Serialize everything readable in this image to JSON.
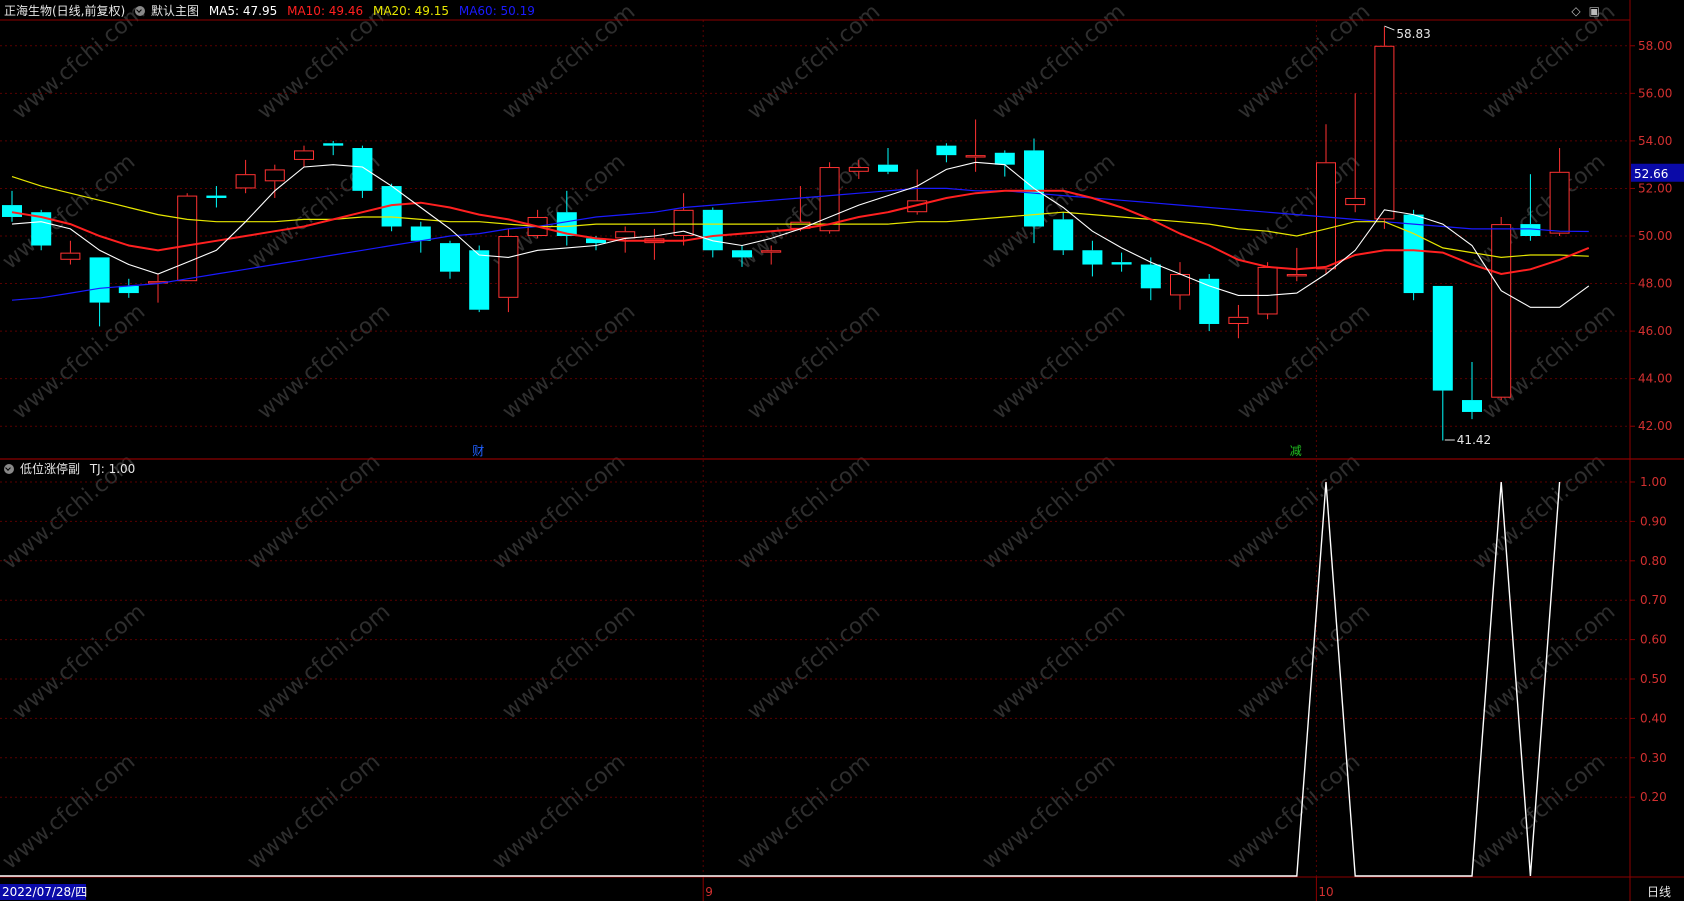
{
  "header": {
    "stock": "正海生物(日线,前复权)",
    "template": "默认主图",
    "ma5": "MA5: 47.95",
    "ma10": "MA10: 49.46",
    "ma20": "MA20: 49.15",
    "ma60": "MA60: 50.19"
  },
  "lower_header": {
    "indicator": "低位涨停副",
    "tj": "TJ: 1.00"
  },
  "price_axis_labels": [
    "58.00",
    "56.00",
    "54.00",
    "52.00",
    "50.00",
    "48.00",
    "46.00",
    "44.00",
    "42.00"
  ],
  "current_price": "52.66",
  "high_marker": "58.83",
  "low_marker": "41.42",
  "event_marks": [
    "财",
    "减"
  ],
  "ind_axis_labels": [
    "1.00",
    "0.90",
    "0.80",
    "0.70",
    "0.60",
    "0.50",
    "0.40",
    "0.30",
    "0.20"
  ],
  "date_label": "2022/07/28/四",
  "month_labels": [
    "9",
    "10"
  ],
  "period": "日线",
  "watermark": "www.cfchi.com",
  "colors": {
    "up": "#ff3232",
    "down": "#00ffff",
    "ma5": "#ffffff",
    "ma10": "#ff2020",
    "ma20": "#e6e600",
    "ma60": "#1a1aff"
  },
  "chart_data": {
    "type": "candlestick",
    "candles": [
      {
        "o": 51.3,
        "c": 50.8,
        "h": 51.9,
        "l": 50.6
      },
      {
        "o": 51.0,
        "c": 49.6,
        "h": 51.1,
        "l": 49.4
      },
      {
        "o": 49.0,
        "c": 49.3,
        "h": 49.8,
        "l": 48.8
      },
      {
        "o": 49.1,
        "c": 47.2,
        "h": 49.1,
        "l": 46.2
      },
      {
        "o": 47.9,
        "c": 47.6,
        "h": 48.2,
        "l": 47.4
      },
      {
        "o": 48.0,
        "c": 48.1,
        "h": 48.4,
        "l": 47.2
      },
      {
        "o": 48.1,
        "c": 51.7,
        "h": 51.8,
        "l": 48.1
      },
      {
        "o": 51.7,
        "c": 51.6,
        "h": 52.1,
        "l": 51.2
      },
      {
        "o": 52.0,
        "c": 52.6,
        "h": 53.2,
        "l": 51.8
      },
      {
        "o": 52.3,
        "c": 52.8,
        "h": 53.0,
        "l": 51.6
      },
      {
        "o": 53.2,
        "c": 53.6,
        "h": 53.8,
        "l": 52.9
      },
      {
        "o": 53.9,
        "c": 53.8,
        "h": 54.0,
        "l": 53.4
      },
      {
        "o": 53.7,
        "c": 51.9,
        "h": 53.8,
        "l": 51.6
      },
      {
        "o": 52.1,
        "c": 50.4,
        "h": 52.2,
        "l": 50.2
      },
      {
        "o": 50.4,
        "c": 49.8,
        "h": 50.6,
        "l": 49.3
      },
      {
        "o": 49.7,
        "c": 48.5,
        "h": 49.8,
        "l": 48.2
      },
      {
        "o": 49.4,
        "c": 46.9,
        "h": 49.6,
        "l": 46.8
      },
      {
        "o": 47.4,
        "c": 50.0,
        "h": 50.3,
        "l": 46.8
      },
      {
        "o": 50.0,
        "c": 50.8,
        "h": 51.1,
        "l": 49.9
      },
      {
        "o": 51.0,
        "c": 50.0,
        "h": 51.9,
        "l": 49.6
      },
      {
        "o": 49.9,
        "c": 49.7,
        "h": 50.0,
        "l": 49.4
      },
      {
        "o": 49.9,
        "c": 50.2,
        "h": 50.4,
        "l": 49.3
      },
      {
        "o": 49.7,
        "c": 49.9,
        "h": 50.3,
        "l": 49.0
      },
      {
        "o": 50.0,
        "c": 51.1,
        "h": 51.8,
        "l": 49.6
      },
      {
        "o": 51.1,
        "c": 49.4,
        "h": 51.2,
        "l": 49.1
      },
      {
        "o": 49.4,
        "c": 49.1,
        "h": 49.6,
        "l": 48.7
      },
      {
        "o": 49.3,
        "c": 49.4,
        "h": 49.6,
        "l": 48.8
      },
      {
        "o": 50.3,
        "c": 50.6,
        "h": 52.1,
        "l": 50.2
      },
      {
        "o": 50.2,
        "c": 52.9,
        "h": 53.1,
        "l": 50.1
      },
      {
        "o": 52.7,
        "c": 52.9,
        "h": 53.2,
        "l": 52.4
      },
      {
        "o": 53.0,
        "c": 52.7,
        "h": 53.7,
        "l": 52.6
      },
      {
        "o": 51.0,
        "c": 51.5,
        "h": 52.8,
        "l": 50.9
      },
      {
        "o": 53.8,
        "c": 53.4,
        "h": 53.9,
        "l": 53.1
      },
      {
        "o": 53.3,
        "c": 53.4,
        "h": 54.9,
        "l": 52.7
      },
      {
        "o": 53.5,
        "c": 53.0,
        "h": 53.6,
        "l": 52.5
      },
      {
        "o": 53.6,
        "c": 50.4,
        "h": 54.1,
        "l": 49.7
      },
      {
        "o": 50.7,
        "c": 49.4,
        "h": 51.0,
        "l": 49.2
      },
      {
        "o": 49.4,
        "c": 48.8,
        "h": 49.8,
        "l": 48.3
      },
      {
        "o": 48.9,
        "c": 48.8,
        "h": 49.3,
        "l": 48.5
      },
      {
        "o": 48.8,
        "c": 47.8,
        "h": 49.1,
        "l": 47.3
      },
      {
        "o": 47.5,
        "c": 48.4,
        "h": 48.9,
        "l": 46.9
      },
      {
        "o": 48.2,
        "c": 46.3,
        "h": 48.4,
        "l": 46.0
      },
      {
        "o": 46.3,
        "c": 46.6,
        "h": 47.1,
        "l": 45.7
      },
      {
        "o": 46.7,
        "c": 48.7,
        "h": 48.9,
        "l": 46.5
      },
      {
        "o": 48.3,
        "c": 48.4,
        "h": 49.5,
        "l": 48.1
      },
      {
        "o": 48.6,
        "c": 53.1,
        "h": 54.7,
        "l": 48.4
      },
      {
        "o": 51.3,
        "c": 51.6,
        "h": 56.0,
        "l": 51.0
      },
      {
        "o": 50.7,
        "c": 58.0,
        "h": 58.8,
        "l": 50.3
      },
      {
        "o": 50.9,
        "c": 47.6,
        "h": 51.1,
        "l": 47.3
      },
      {
        "o": 47.9,
        "c": 43.5,
        "h": 47.9,
        "l": 41.4
      },
      {
        "o": 43.1,
        "c": 42.6,
        "h": 44.7,
        "l": 42.3
      },
      {
        "o": 43.2,
        "c": 50.5,
        "h": 50.8,
        "l": 43.1
      },
      {
        "o": 50.5,
        "c": 50.0,
        "h": 52.6,
        "l": 49.8
      },
      {
        "o": 50.1,
        "c": 52.7,
        "h": 53.7,
        "l": 50.0
      }
    ],
    "ma5": [
      50.5,
      50.6,
      50.3,
      49.4,
      48.8,
      48.4,
      48.9,
      49.4,
      50.6,
      51.9,
      52.9,
      53.0,
      52.9,
      52.1,
      51.2,
      50.3,
      49.2,
      49.1,
      49.4,
      49.5,
      49.6,
      49.9,
      50.0,
      50.2,
      49.8,
      49.6,
      49.9,
      50.3,
      50.8,
      51.3,
      51.7,
      52.1,
      52.8,
      53.1,
      53.0,
      52.0,
      51.2,
      50.2,
      49.5,
      48.9,
      48.4,
      47.9,
      47.5,
      47.5,
      47.6,
      48.4,
      49.4,
      51.1,
      50.9,
      50.5,
      49.6,
      47.7,
      47.0,
      47.0,
      47.9
    ],
    "ma10": [
      51.0,
      50.8,
      50.5,
      50.0,
      49.6,
      49.4,
      49.6,
      49.8,
      50.0,
      50.2,
      50.4,
      50.7,
      51.0,
      51.3,
      51.4,
      51.2,
      50.9,
      50.7,
      50.4,
      50.1,
      49.9,
      49.8,
      49.8,
      49.8,
      50.0,
      50.1,
      50.2,
      50.3,
      50.5,
      50.8,
      51.0,
      51.3,
      51.6,
      51.8,
      51.9,
      51.9,
      51.9,
      51.6,
      51.2,
      50.7,
      50.1,
      49.6,
      49.0,
      48.7,
      48.6,
      48.7,
      49.2,
      49.4,
      49.4,
      49.3,
      48.8,
      48.4,
      48.6,
      49.0,
      49.5
    ],
    "ma20": [
      52.5,
      52.1,
      51.8,
      51.5,
      51.2,
      50.9,
      50.7,
      50.6,
      50.6,
      50.6,
      50.7,
      50.7,
      50.8,
      50.8,
      50.7,
      50.6,
      50.6,
      50.5,
      50.4,
      50.4,
      50.5,
      50.5,
      50.5,
      50.5,
      50.5,
      50.5,
      50.5,
      50.5,
      50.5,
      50.5,
      50.5,
      50.6,
      50.6,
      50.7,
      50.8,
      50.9,
      51.0,
      50.9,
      50.8,
      50.7,
      50.6,
      50.5,
      50.3,
      50.2,
      50.0,
      50.3,
      50.6,
      50.6,
      50.1,
      49.5,
      49.3,
      49.1,
      49.2,
      49.2,
      49.15
    ],
    "ma60": [
      47.3,
      47.4,
      47.6,
      47.8,
      47.9,
      48.0,
      48.2,
      48.4,
      48.6,
      48.8,
      49.0,
      49.2,
      49.4,
      49.6,
      49.8,
      50.0,
      50.1,
      50.3,
      50.4,
      50.6,
      50.8,
      50.9,
      51.0,
      51.2,
      51.3,
      51.4,
      51.5,
      51.6,
      51.7,
      51.8,
      51.9,
      52.0,
      52.0,
      51.9,
      51.9,
      51.8,
      51.7,
      51.6,
      51.5,
      51.4,
      51.3,
      51.2,
      51.1,
      51.0,
      50.9,
      50.8,
      50.7,
      50.6,
      50.5,
      50.4,
      50.3,
      50.3,
      50.3,
      50.2,
      50.19
    ],
    "indicator": {
      "name": "TJ",
      "values": [
        0,
        0,
        0,
        0,
        0,
        0,
        0,
        0,
        0,
        0,
        0,
        0,
        0,
        0,
        0,
        0,
        0,
        0,
        0,
        0,
        0,
        0,
        0,
        0,
        0,
        0,
        0,
        0,
        0,
        0,
        0,
        0,
        0,
        0,
        0,
        0,
        0,
        0,
        0,
        0,
        0,
        0,
        0,
        0,
        0,
        1,
        0,
        0,
        0,
        0,
        0,
        1,
        0,
        1
      ],
      "ylim": [
        0,
        1.0
      ]
    },
    "price_ylim": [
      41.0,
      59.0
    ]
  }
}
